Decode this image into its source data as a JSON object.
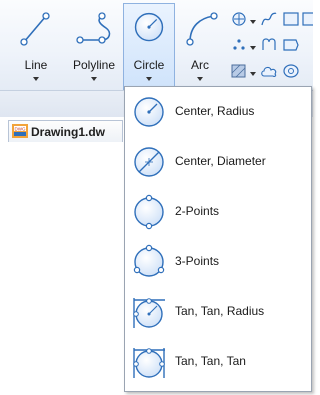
{
  "ribbon": {
    "tools": [
      {
        "label": "Line",
        "icon": "line-icon"
      },
      {
        "label": "Polyline",
        "icon": "polyline-icon"
      },
      {
        "label": "Circle",
        "icon": "circle-icon"
      },
      {
        "label": "Arc",
        "icon": "arc-icon"
      }
    ],
    "small_tools": [
      "move-icon",
      "spline-icon",
      "rectangle-icon",
      "points-icon",
      "revision-cloud-icon",
      "hatch-icon",
      "cloud-icon",
      "ellipse-icon"
    ]
  },
  "document_tab": {
    "label": "Drawing1.dw",
    "icon": "dwg-file-icon"
  },
  "circle_menu": {
    "items": [
      {
        "label": "Center, Radius",
        "icon": "center-radius-icon"
      },
      {
        "label": "Center, Diameter",
        "icon": "center-diameter-icon"
      },
      {
        "label": "2-Points",
        "icon": "two-points-icon"
      },
      {
        "label": "3-Points",
        "icon": "three-points-icon"
      },
      {
        "label": "Tan, Tan, Radius",
        "icon": "tan-tan-radius-icon"
      },
      {
        "label": "Tan, Tan, Tan",
        "icon": "tan-tan-tan-icon"
      }
    ]
  },
  "colors": {
    "icon_blue": "#2f6fba",
    "icon_fill": "#dbe9fb",
    "ribbon_bg": "#eef3fa",
    "selected_border": "#8fb2e0"
  }
}
